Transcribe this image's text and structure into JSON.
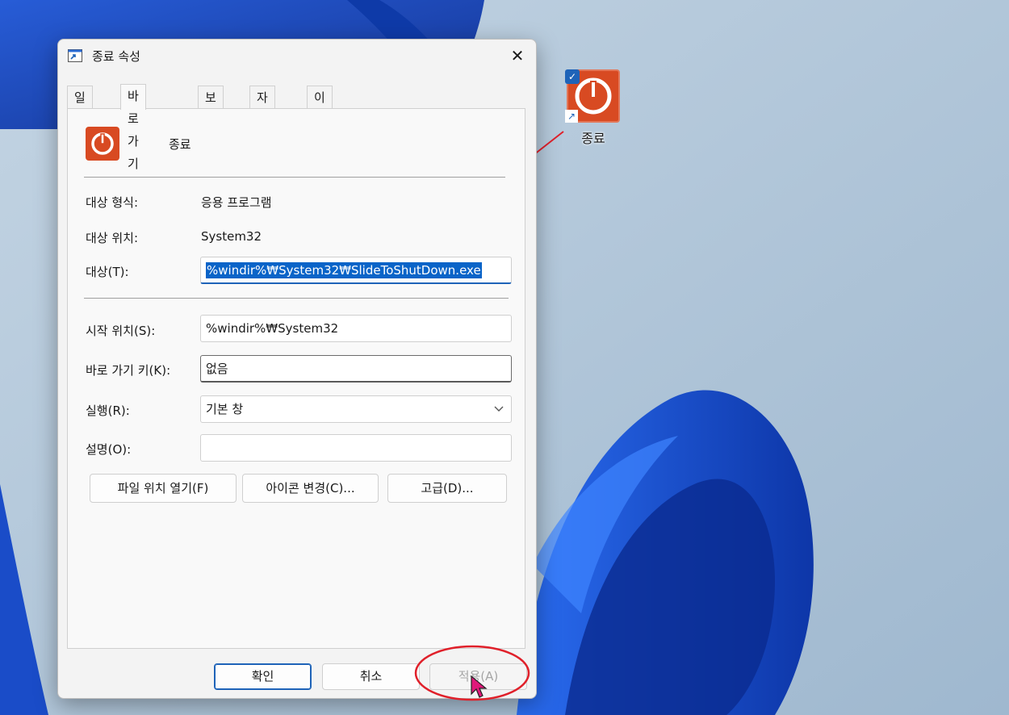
{
  "dialog": {
    "title": "종료 속성",
    "close_glyph": "✕",
    "tabs": [
      {
        "label": "일반"
      },
      {
        "label": "바로 가기"
      },
      {
        "label": "보안"
      },
      {
        "label": "자세히"
      },
      {
        "label": "이전 버전"
      }
    ],
    "active_tab": "바로 가기",
    "shortcut_name": "종료",
    "fields": {
      "target_type_label": "대상 형식:",
      "target_type_value": "응용 프로그램",
      "target_location_label": "대상 위치:",
      "target_location_value": "System32",
      "target_label": "대상(T):",
      "target_value": "%windir%₩System32₩SlideToShutDown.exe",
      "start_in_label": "시작 위치(S):",
      "start_in_value": "%windir%₩System32",
      "shortcut_key_label": "바로 가기 키(K):",
      "shortcut_key_value": "없음",
      "run_label": "실행(R):",
      "run_value": "기본 창",
      "comment_label": "설명(O):",
      "comment_value": ""
    },
    "buttons": {
      "open_file_location": "파일 위치 열기(F)",
      "change_icon": "아이콘 변경(C)...",
      "advanced": "고급(D)...",
      "ok": "확인",
      "cancel": "취소",
      "apply": "적용(A)"
    }
  },
  "desktop": {
    "icon_label": "종료",
    "selected_check": "✓",
    "shortcut_arrow": "↗"
  },
  "colors": {
    "accent": "#1e63b8",
    "power_icon": "#d84a22",
    "annotation": "#e0202a",
    "cursor": "#e0187a"
  }
}
